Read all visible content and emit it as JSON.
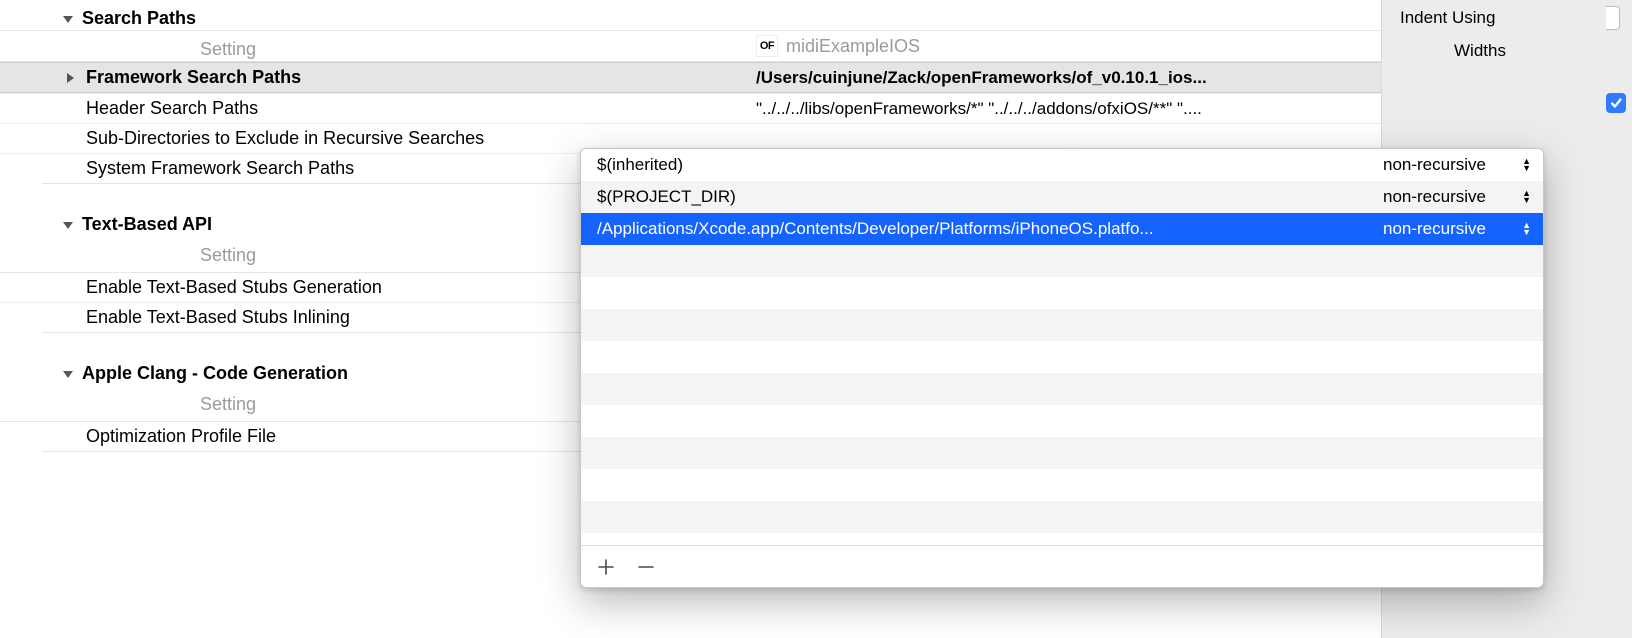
{
  "target": {
    "icon_text": "OF",
    "name": "midiExampleIOS"
  },
  "sections": {
    "search_paths": {
      "title": "Search Paths",
      "setting_heading": "Setting",
      "rows": [
        {
          "name": "Framework Search Paths",
          "value": "/Users/cuinjune/Zack/openFrameworks/of_v0.10.1_ios...",
          "selected": true,
          "has_children": true
        },
        {
          "name": "Header Search Paths",
          "value": "\"../../../libs/openFrameworks/*\"   \"../../../addons/ofxiOS/**\" \"....",
          "selected": false,
          "has_children": false
        },
        {
          "name": "Sub-Directories to Exclude in Recursive Searches",
          "value": "",
          "selected": false,
          "has_children": false
        },
        {
          "name": "System Framework Search Paths",
          "value": "",
          "selected": false,
          "has_children": false
        }
      ]
    },
    "text_based_api": {
      "title": "Text-Based API",
      "setting_heading": "Setting",
      "rows": [
        {
          "name": "Enable Text-Based Stubs Generation",
          "value": ""
        },
        {
          "name": "Enable Text-Based Stubs Inlining",
          "value": ""
        }
      ]
    },
    "clang_codegen": {
      "title": "Apple Clang - Code Generation",
      "setting_heading": "Setting",
      "rows": [
        {
          "name": "Optimization Profile File",
          "value": ""
        }
      ]
    }
  },
  "popover": {
    "rows": [
      {
        "path": "$(inherited)",
        "mode": "non-recursive",
        "selected": false
      },
      {
        "path": "$(PROJECT_DIR)",
        "mode": "non-recursive",
        "selected": false
      },
      {
        "path": "/Applications/Xcode.app/Contents/Developer/Platforms/iPhoneOS.platfo...",
        "mode": "non-recursive",
        "selected": true
      }
    ]
  },
  "sidebar": {
    "indent_using_label": "Indent Using",
    "widths_label": "Widths",
    "checkbox_checked": true
  }
}
